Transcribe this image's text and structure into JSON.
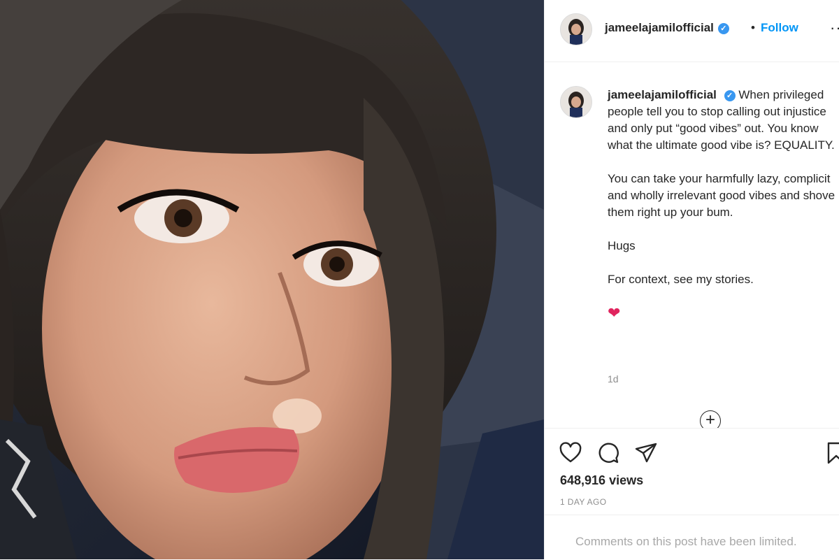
{
  "post": {
    "username": "jameelajamil official",
    "username_display": "jameelajamilofficial",
    "verified_glyph": "✓",
    "separator": "•",
    "follow_label": "Follow",
    "more_label": "···",
    "caption": {
      "line1": "When privileged people tell you to stop calling out injustice and only put “good vibes” out. You know what the ultimate good vibe is? EQUALITY.",
      "para2": "You can take your harmfully lazy, complicit and wholly irrelevant good vibes and shove them right up your bum.",
      "para3": "Hugs",
      "para4": "For context, see my stories.",
      "emoji": "❤",
      "time": "1d"
    },
    "add_comment_glyph": "+",
    "views": "648,916 views",
    "posted_ago": "1 DAY AGO",
    "comments_notice": "Comments on this post have been limited."
  },
  "colors": {
    "follow": "#0095f6",
    "verified": "#3897f0",
    "muted": "#8e8e8e",
    "heart": "#e0245e"
  },
  "icons": [
    "verified-badge-icon",
    "more-options-icon",
    "like-heart-icon",
    "comment-icon",
    "share-icon",
    "save-bookmark-icon",
    "add-comment-icon"
  ]
}
